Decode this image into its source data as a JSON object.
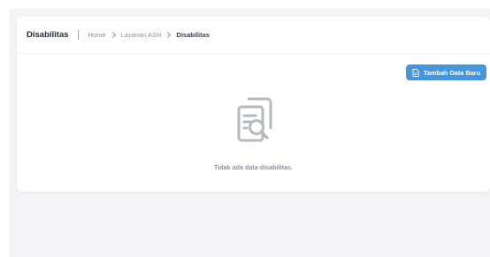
{
  "header": {
    "title": "Disabilitas",
    "breadcrumb": [
      "Home",
      "Layanan ASN",
      "Disabilitas"
    ]
  },
  "actions": {
    "add_label": "Tambah Data Baru",
    "add_icon": "document-icon"
  },
  "empty_state": {
    "icon": "document-search-icon",
    "message": "Tidak ada data disabilitas."
  },
  "colors": {
    "accent": "#4a95d6",
    "background": "#f3f4f8",
    "icon_gray": "#b5b9be"
  }
}
